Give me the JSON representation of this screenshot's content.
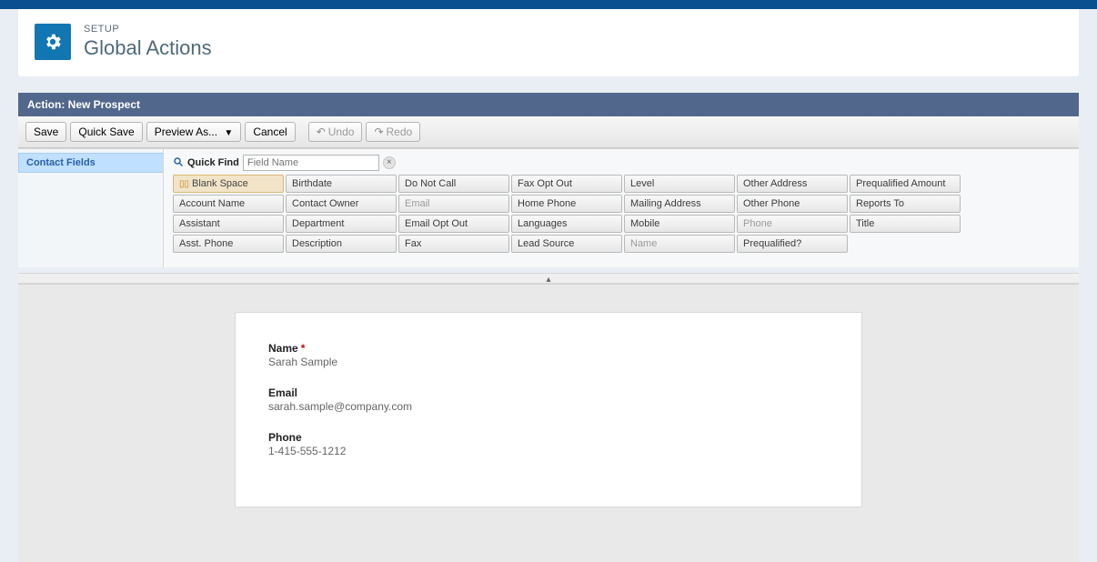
{
  "header": {
    "eyebrow": "SETUP",
    "title": "Global Actions"
  },
  "action_title": "Action: New Prospect",
  "toolbar": {
    "save": "Save",
    "quick_save": "Quick Save",
    "preview": "Preview As...",
    "cancel": "Cancel",
    "undo": "Undo",
    "redo": "Redo"
  },
  "sidebar": {
    "active_tab": "Contact Fields"
  },
  "quickfind": {
    "label": "Quick Find",
    "placeholder": "Field Name"
  },
  "palette": {
    "fields": [
      {
        "label": "Blank Space",
        "blank": true
      },
      {
        "label": "Birthdate"
      },
      {
        "label": "Do Not Call"
      },
      {
        "label": "Fax Opt Out"
      },
      {
        "label": "Level"
      },
      {
        "label": "Other Address"
      },
      {
        "label": "Prequalified Amount"
      },
      {
        "label": "Account Name"
      },
      {
        "label": "Contact Owner"
      },
      {
        "label": "Email",
        "disabled": true
      },
      {
        "label": "Home Phone"
      },
      {
        "label": "Mailing Address"
      },
      {
        "label": "Other Phone"
      },
      {
        "label": "Reports To"
      },
      {
        "label": "Assistant"
      },
      {
        "label": "Department"
      },
      {
        "label": "Email Opt Out"
      },
      {
        "label": "Languages"
      },
      {
        "label": "Mobile"
      },
      {
        "label": "Phone",
        "disabled": true
      },
      {
        "label": "Title"
      },
      {
        "label": "Asst. Phone"
      },
      {
        "label": "Description"
      },
      {
        "label": "Fax"
      },
      {
        "label": "Lead Source"
      },
      {
        "label": "Name",
        "disabled": true
      },
      {
        "label": "Prequalified?"
      }
    ]
  },
  "canvas": {
    "fields": [
      {
        "label": "Name",
        "value": "Sarah Sample",
        "required": true
      },
      {
        "label": "Email",
        "value": "sarah.sample@company.com",
        "required": false
      },
      {
        "label": "Phone",
        "value": "1-415-555-1212",
        "required": false
      }
    ]
  }
}
